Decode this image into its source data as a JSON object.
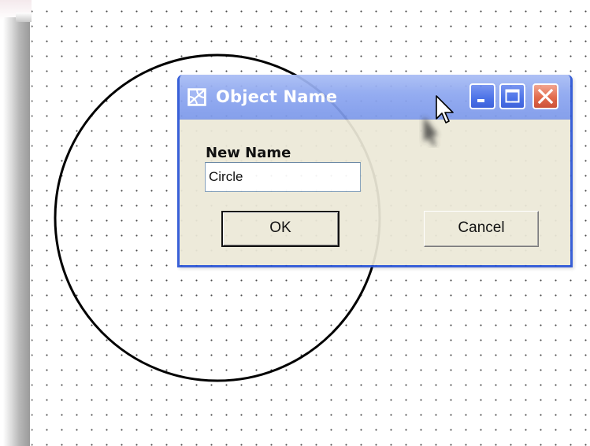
{
  "dialog": {
    "title": "Object Name",
    "icon": "shape-tool-icon",
    "field_label": "New Name",
    "name_value": "Circle",
    "ok_label": "OK",
    "cancel_label": "Cancel",
    "window_buttons": [
      "minimize",
      "maximize",
      "close"
    ]
  },
  "canvas": {
    "shape": "circle",
    "grid": "dotted"
  },
  "colors": {
    "titlebar": "#8ca6f0",
    "dialog_border": "#2b55d6",
    "dialog_face": "#ece9d8",
    "close_button": "#e0603f"
  }
}
